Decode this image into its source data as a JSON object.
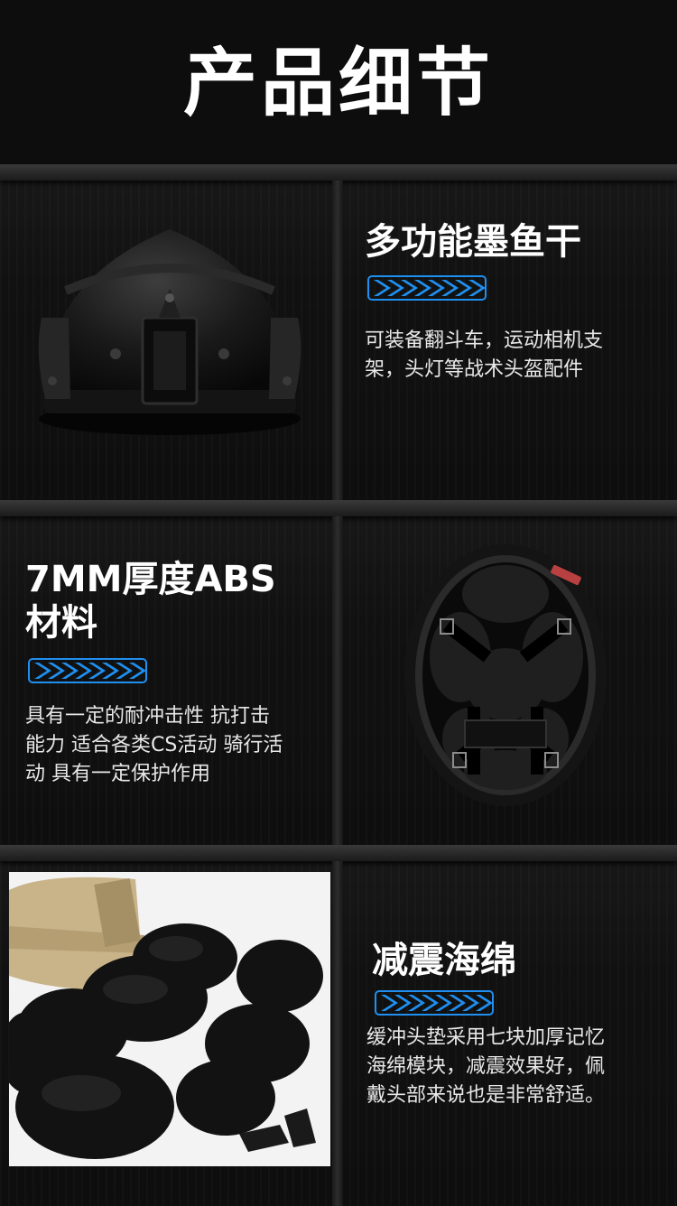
{
  "header": {
    "title": "产品细节"
  },
  "features": [
    {
      "title": "多功能墨鱼干",
      "desc_lines": [
        "可装备翻斗车，运动相机支",
        "架，头灯等战术头盔配件"
      ]
    },
    {
      "title_lines": [
        "7MM厚度ABS",
        "材料"
      ],
      "desc_lines": [
        "具有一定的耐冲击性 抗打击",
        "能力 适合各类CS活动 骑行活",
        "动 具有一定保护作用"
      ]
    },
    {
      "title": "减震海绵",
      "desc_lines": [
        "缓冲头垫采用七块加厚记忆",
        "海绵模块，减震效果好，佩",
        "戴头部来说也是非常舒适。"
      ]
    }
  ],
  "colors": {
    "arrow_blue": "#1f8ff0",
    "background": "#0b0b0b"
  },
  "icons": [
    "chevron-arrows-icon",
    "helmet-front-image",
    "helmet-interior-image",
    "foam-pads-image"
  ]
}
